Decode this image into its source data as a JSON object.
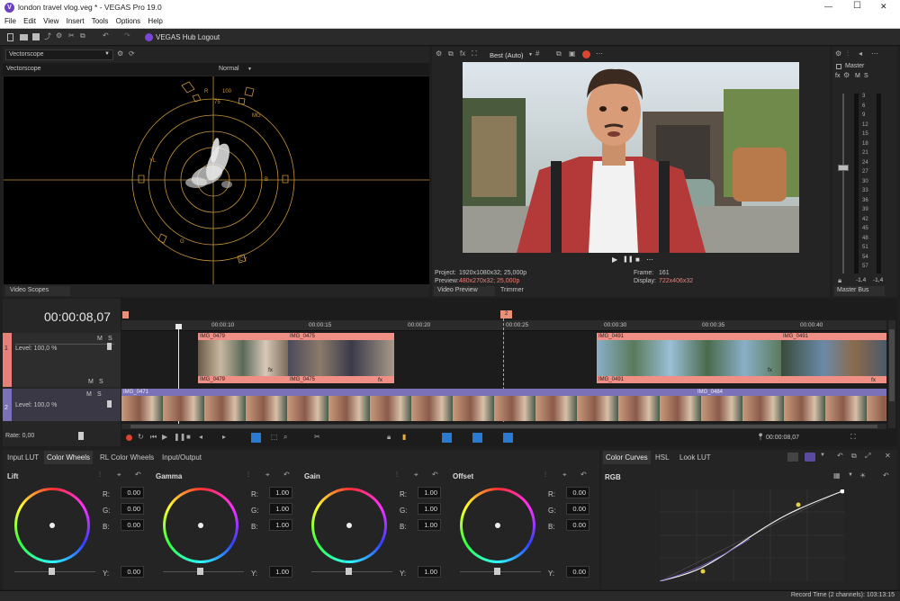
{
  "app": {
    "title": "london travel vlog.veg * - VEGAS Pro 19.0",
    "logo_letter": "V"
  },
  "window_controls": {
    "minimize": "—",
    "maximize": "☐",
    "close": "✕"
  },
  "menu": [
    "File",
    "Edit",
    "View",
    "Insert",
    "Tools",
    "Options",
    "Help"
  ],
  "toolbar": {
    "hub_label": "VEGAS Hub Logout",
    "icons": [
      "new-icon",
      "open-icon",
      "save-icon",
      "render-icon",
      "gear-icon",
      "script-icon",
      "copy-icon",
      "undo-icon",
      "redo-icon"
    ]
  },
  "scopes": {
    "selector": "Vectorscope",
    "title": "Vectorscope",
    "mode": "Normal",
    "tab": "Video Scopes",
    "labels": {
      "r": "R",
      "mg": "MG",
      "b": "B",
      "g": "G",
      "cy": "CY",
      "yl": "YL",
      "pct100": "100",
      "pct75": "75"
    }
  },
  "preview": {
    "quality": "Best (Auto)",
    "project_label": "Project:",
    "project_value": "1920x1080x32; 25,000p",
    "preview_label": "Preview:",
    "preview_value": "480x270x32; 25,000p",
    "frame_label": "Frame:",
    "frame_value": "161",
    "display_label": "Display:",
    "display_value": "722x406x32",
    "tab_preview": "Video Preview",
    "tab_trimmer": "Trimmer",
    "transport": [
      "▶",
      "❚❚",
      "■",
      "⋯"
    ]
  },
  "master": {
    "title": "Master",
    "m": "M",
    "s": "S",
    "fx": "fx",
    "scale": [
      "3",
      "6",
      "9",
      "12",
      "15",
      "18",
      "21",
      "24",
      "27",
      "30",
      "33",
      "36",
      "39",
      "42",
      "45",
      "48",
      "51",
      "54",
      "57"
    ],
    "readout_l": "-1,4",
    "readout_r": "-1,4",
    "tab": "Master Bus"
  },
  "timeline": {
    "timecode": "00:00:08,07",
    "ruler": [
      "00:00:10",
      "00:00:15",
      "00:00:20",
      "00:00:25",
      "00:00:30",
      "00:00:35",
      "00:00:40"
    ],
    "marker": "2",
    "track1": {
      "num": "1",
      "level": "Level: 100,0 %",
      "m": "M",
      "s": "S"
    },
    "track2": {
      "num": "2",
      "level": "Level: 100,0 %",
      "m": "M",
      "s": "S"
    },
    "clips": [
      "IMG_0479",
      "IMG_0475",
      "IMG_0479",
      "IMG_0475",
      "IMG_0491",
      "IMG_0491",
      "IMG_0491",
      "IMG_0471",
      "IMG_0484"
    ],
    "fx": "fx",
    "rate": "Rate: 0,00",
    "end_time": "00:00:08,07"
  },
  "color": {
    "tabs_left": [
      "Input LUT",
      "Color Wheels",
      "RL Color Wheels",
      "Input/Output"
    ],
    "tabs_right": [
      "Color Curves",
      "HSL",
      "Look LUT"
    ],
    "wheels": [
      {
        "name": "Lift",
        "r": "0.00",
        "g": "0.00",
        "b": "0.00",
        "y": "0.00"
      },
      {
        "name": "Gamma",
        "r": "1.00",
        "g": "1.00",
        "b": "1.00",
        "y": "1.00"
      },
      {
        "name": "Gain",
        "r": "1.00",
        "g": "1.00",
        "b": "1.00",
        "y": "1.00"
      },
      {
        "name": "Offset",
        "r": "0.00",
        "g": "0.00",
        "b": "0.00",
        "y": "0.00"
      }
    ],
    "channel_labels": {
      "r": "R:",
      "g": "G:",
      "b": "B:",
      "y": "Y:"
    },
    "curves_channel": "RGB"
  },
  "status": {
    "record_time": "Record Time (2 channels): 103:13:15"
  },
  "colors": {
    "accent_red": "#e8807a",
    "clip_pink": "#f08f86",
    "track_purple": "#7a71b8",
    "scope_orange": "#c8963c"
  }
}
